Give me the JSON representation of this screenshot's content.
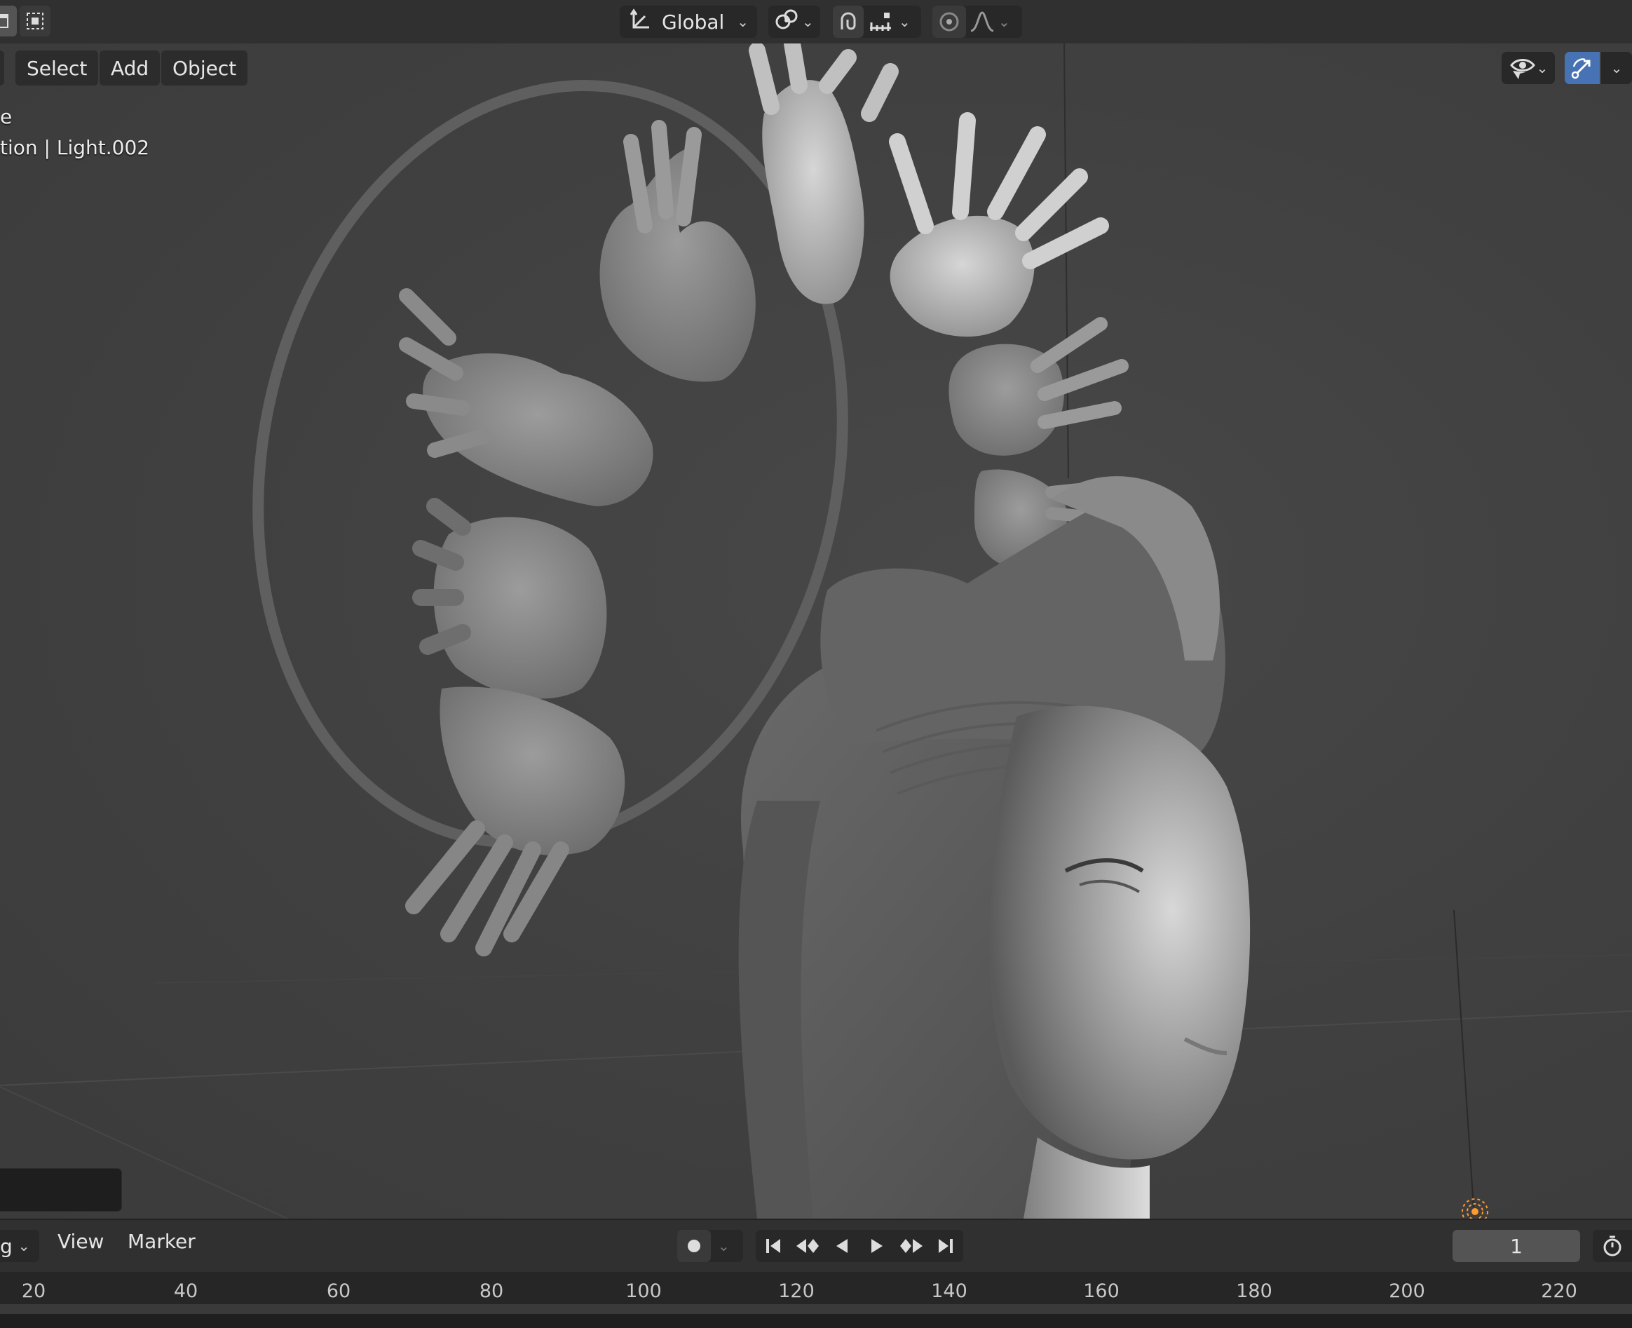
{
  "header": {
    "transform_orientation": "Global",
    "icons": [
      "select-box-icon",
      "transform-orientation-icon",
      "pivot-point-icon",
      "snap-magnet-icon",
      "snap-increment-icon",
      "proportional-edit-icon",
      "falloff-curve-icon"
    ]
  },
  "viewport": {
    "menus": [
      {
        "label": "Select"
      },
      {
        "label": "Add"
      },
      {
        "label": "Object"
      }
    ],
    "info_line1": "e",
    "info_line2": "tion | Light.002",
    "right_icons": [
      "visibility-eye-icon",
      "gizmo-icon"
    ]
  },
  "timeline": {
    "mode_dropdown_label": "g",
    "menus": [
      "View",
      "Marker"
    ],
    "current_frame": "1",
    "ruler_labels": [
      "20",
      "40",
      "60",
      "80",
      "100",
      "120",
      "140",
      "160",
      "180",
      "200",
      "220"
    ]
  },
  "colors": {
    "accent_blue": "#4772b3",
    "light_orange": "#ff9a2e"
  }
}
